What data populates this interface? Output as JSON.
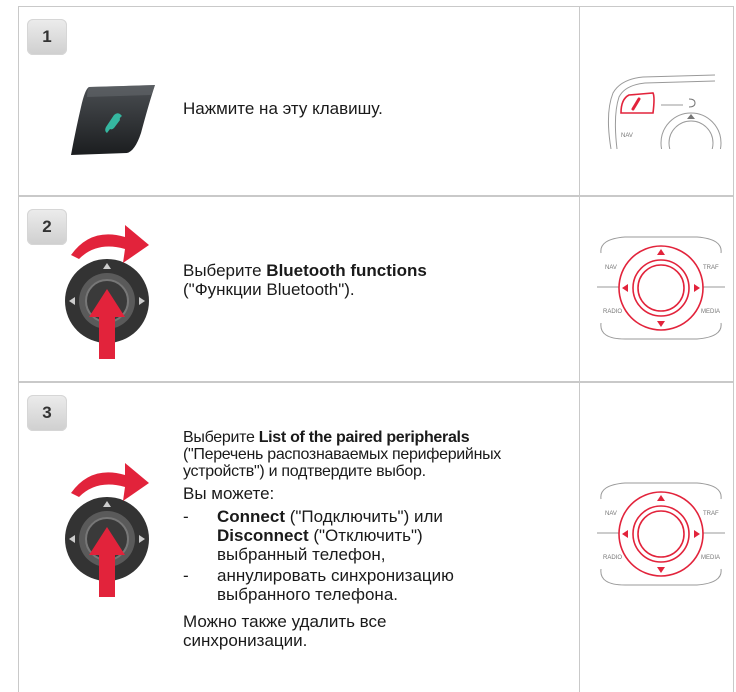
{
  "steps": [
    {
      "number": "1",
      "text": "Нажмите на эту клавишу."
    },
    {
      "number": "2",
      "text_prefix": "Выберите ",
      "text_bold": "Bluetooth functions",
      "text_suffix": "(\"Функции Bluetooth\")."
    },
    {
      "number": "3",
      "intro_prefix": "Выберите ",
      "intro_bold": "List of the paired peripherals",
      "intro_suffix": "(\"Перечень распознаваемых периферийных устройств\") и подтвердите выбор.",
      "can_do": "Вы можете:",
      "bullets": [
        {
          "dash": "-",
          "bold1": "Connect",
          "text1": " (\"Подключить\") или ",
          "bold2": "Disconnect",
          "text2": " (\"Отключить\") выбранный телефон,"
        },
        {
          "dash": "-",
          "text": "аннулировать синхронизацию выбранного телефона."
        }
      ],
      "footer": "Можно также удалить все синхронизации."
    }
  ],
  "panel_labels": {
    "nav": "NAV",
    "traf": "TRAF",
    "radio": "RADIO",
    "media": "MEDIA"
  },
  "colors": {
    "accent": "#e2233b",
    "border": "#c9c9c9",
    "badge": "#d9d9d9"
  }
}
